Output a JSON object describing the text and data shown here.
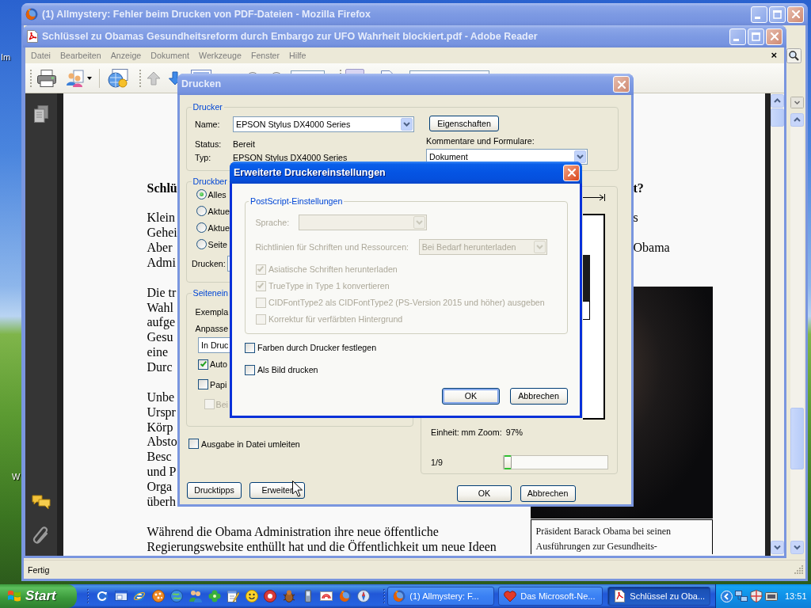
{
  "desktop": {
    "icon_labels": [
      "Im",
      "W"
    ]
  },
  "firefox": {
    "title": "(1) Allmystery: Fehler beim Drucken von PDF-Dateien - Mozilla Firefox",
    "active": false,
    "status": "Fertig"
  },
  "reader": {
    "title": "Schlüssel zu Obamas Gesundheitsreform durch Embargo zur UFO Wahrheit blockiert.pdf - Adobe Reader",
    "active": false,
    "menu": [
      "Datei",
      "Bearbeiten",
      "Anzeige",
      "Dokument",
      "Werkzeuge",
      "Fenster",
      "Hilfe"
    ],
    "close_document": "×",
    "document": {
      "paragraphs": [
        {
          "kind": "heading",
          "lines": [
            {
              "start": "Schlü",
              "end": "t?"
            }
          ]
        },
        {
          "kind": "body",
          "lines": [
            {
              "start": "Klein",
              "end": "s"
            },
            {
              "start": "Gehei"
            },
            {
              "start": "Aber",
              "end": "Obama"
            },
            {
              "start": "Admi"
            }
          ]
        },
        {
          "kind": "body",
          "lines": [
            {
              "start": "Die tr"
            },
            {
              "start": "Wahl"
            },
            {
              "start": "aufge"
            },
            {
              "start": "Gesu"
            },
            {
              "start": "eine"
            },
            {
              "start": "Durc"
            }
          ]
        },
        {
          "kind": "body",
          "lines": [
            {
              "start": "Unbe"
            },
            {
              "start": "Urspr"
            },
            {
              "start": "Körp"
            },
            {
              "start": "Absto"
            },
            {
              "start": "Besc"
            },
            {
              "start": "und P"
            },
            {
              "start": "Orga"
            },
            {
              "start": "überh"
            }
          ]
        },
        {
          "kind": "body",
          "lines": [
            {
              "start": "Während die Obama Administration ihre neue öffentliche"
            },
            {
              "start": "Regierungswebsite enthüllt hat und die Öffentlichkeit um neue Ideen"
            }
          ]
        }
      ],
      "caption": [
        "Präsident Barack Obama bei seinen",
        "Ausführungen zur Gesundheits-"
      ]
    }
  },
  "print_dialog": {
    "title": "Drucken",
    "active": false,
    "printer": {
      "legend": "Drucker",
      "name_label": "Name:",
      "name_value": "EPSON Stylus DX4000 Series",
      "status_label": "Status:",
      "status_value": "Bereit",
      "type_label": "Typ:",
      "type_value": "EPSON Stylus DX4000 Series",
      "properties_button": "Eigenschaften",
      "comments_label": "Kommentare und Formulare:",
      "comments_value": "Dokument"
    },
    "range": {
      "legend": "Druckber",
      "options": [
        {
          "label": "Alles",
          "selected": true
        },
        {
          "label": "Aktue",
          "selected": false
        },
        {
          "label": "Aktue",
          "selected": false
        },
        {
          "label": "Seite",
          "selected": false
        }
      ],
      "print_label": "Drucken:"
    },
    "page_setup": {
      "legend": "Seitenein",
      "copies_label": "Exempla",
      "fit_label": "Anpasse",
      "fit_value": "In Druc",
      "options": [
        {
          "label": "Auto",
          "checked": true,
          "disabled": false
        },
        {
          "label": "Papi",
          "checked": false,
          "disabled": false
        },
        {
          "label": "Bei",
          "checked": false,
          "disabled": true
        }
      ]
    },
    "print_to_file": {
      "label": "Ausgabe in Datei umleiten",
      "checked": false
    },
    "preview": {
      "units": "Einheit: mm Zoom:",
      "zoom": "97%",
      "page": "1/9",
      "level": 0
    },
    "buttons": [
      {
        "label": "Drucktipps"
      },
      {
        "label": "Erweiter"
      },
      {
        "label": "OK"
      },
      {
        "label": "Abbrechen"
      }
    ]
  },
  "advanced_dialog": {
    "title": "Erweiterte Druckereinstellungen",
    "active": true,
    "postscript": {
      "legend": "PostScript-Einstellungen",
      "disabled": true,
      "language_label": "Sprache:",
      "fonts_label": "Richtlinien für Schriften und Ressourcen:",
      "fonts_value": "Bei Bedarf herunterladen",
      "options": [
        {
          "label": "Asiatische Schriften herunterladen",
          "checked": true
        },
        {
          "label": "TrueType in Type 1 konvertieren",
          "checked": true
        },
        {
          "label": "CIDFontType2 als CIDFontType2 (PS-Version 2015 und höher) ausgeben",
          "checked": false
        },
        {
          "label": "Korrektur für verfärbten Hintergrund",
          "checked": false
        }
      ]
    },
    "options": [
      {
        "label": "Farben durch Drucker festlegen",
        "checked": false
      },
      {
        "label": "Als Bild drucken",
        "checked": false
      }
    ],
    "buttons": [
      {
        "label": "OK",
        "default": true
      },
      {
        "label": "Abbrechen",
        "default": false
      }
    ]
  },
  "taskbar": {
    "start": "Start",
    "tasks": [
      {
        "label": "(1) Allmystery: F...",
        "selected": false
      },
      {
        "label": "Das Microsoft-Ne...",
        "selected": false
      },
      {
        "label": "Schlüssel zu Oba...",
        "selected": true
      }
    ],
    "clock": "13:51"
  }
}
